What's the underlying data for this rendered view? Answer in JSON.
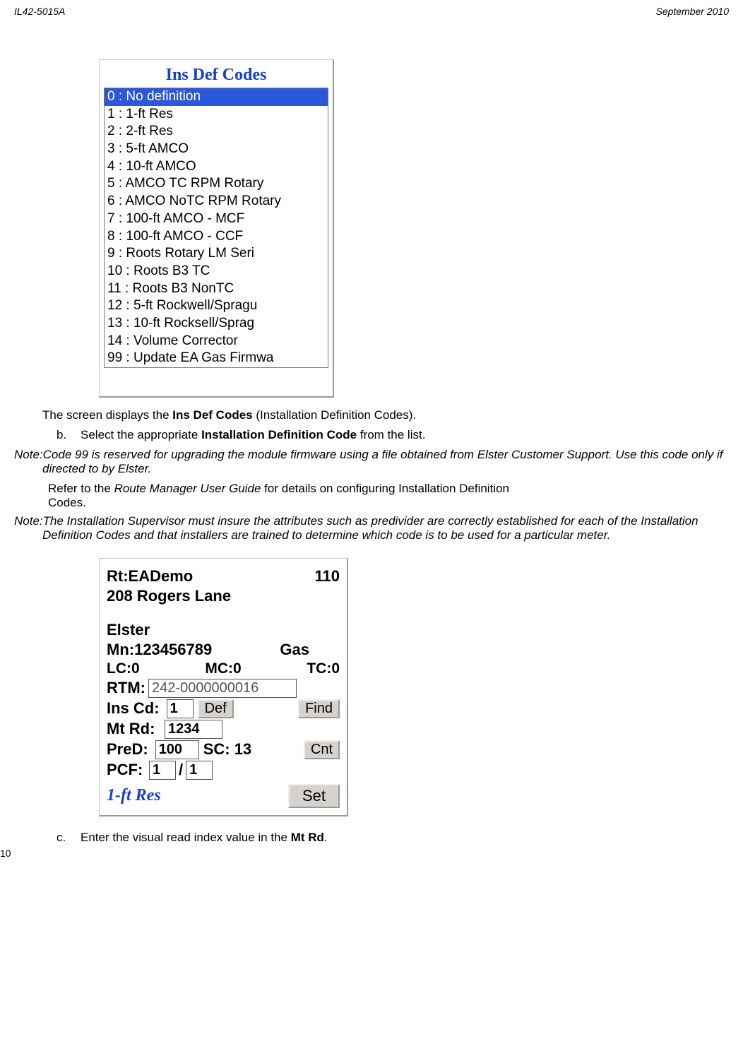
{
  "header": {
    "left": "IL42-5015A",
    "right": "September 2010",
    "page_number": "10"
  },
  "panel1": {
    "title": "Ins Def Codes",
    "items": [
      {
        "text": "0 : No definition",
        "selected": true
      },
      {
        "text": "1 : 1-ft Res"
      },
      {
        "text": "2 : 2-ft Res"
      },
      {
        "text": "3 : 5-ft AMCO"
      },
      {
        "text": "4 : 10-ft AMCO"
      },
      {
        "text": "5 : AMCO TC RPM Rotary"
      },
      {
        "text": "6 : AMCO NoTC RPM Rotary"
      },
      {
        "text": "7 : 100-ft AMCO - MCF"
      },
      {
        "text": "8 : 100-ft AMCO - CCF"
      },
      {
        "text": "9 : Roots Rotary LM Seri"
      },
      {
        "text": "10 : Roots B3 TC"
      },
      {
        "text": "11 : Roots B3 NonTC"
      },
      {
        "text": "12 : 5-ft Rockwell/Spragu"
      },
      {
        "text": "13 : 10-ft Rocksell/Sprag"
      },
      {
        "text": "14 : Volume Corrector"
      },
      {
        "text": "99 : Update EA Gas Firmwa"
      }
    ]
  },
  "text": {
    "screen_displays_pre": "The screen displays the ",
    "ins_def_codes_bold": "Ins Def Codes",
    "screen_displays_post": " (Installation Definition Codes).",
    "b_bullet": "b.",
    "b_text_pre": "Select the appropriate ",
    "b_text_bold": "Installation Definition Code",
    "b_text_post": " from the list.",
    "note1_prefix": "Note: ",
    "note1_body": "Code 99 is reserved for upgrading the module firmware using a file obtained from Elster Customer Support. Use this code only if directed to by Elster.",
    "refer_pre": "Refer to the ",
    "refer_ital": "Route Manager User Guide",
    "refer_post": " for details on configuring Installation Definition Codes.",
    "note2_prefix": "Note: ",
    "note2_body": "The Installation Supervisor must insure the attributes such as predivider are correctly established for each of the Installation Definition Codes and that installers are trained to determine which code is to be used for a particular meter.",
    "c_bullet": "c.",
    "c_text_pre": "Enter the visual read index value in the ",
    "c_text_bold": "Mt Rd",
    "c_text_post": "."
  },
  "panel2": {
    "rt_label": "Rt:EADemo",
    "rt_num": "110",
    "address": "208 Rogers Lane",
    "company": "Elster",
    "mn_label": "Mn:123456789",
    "service": "Gas",
    "lc": "LC:0",
    "mc": "MC:0",
    "tc": "TC:0",
    "rtm_label": "RTM:",
    "rtm_value": "242-0000000016",
    "inscd_label": "Ins Cd:",
    "inscd_value": "1",
    "def_btn": "Def",
    "find_btn": "Find",
    "mtrd_label": "Mt Rd:",
    "mtrd_value": "1234",
    "pred_label": "PreD:",
    "pred_value": "100",
    "sc_label": "SC: 13",
    "cnt_btn": "Cnt",
    "pcf_label": "PCF:",
    "pcf_a": "1",
    "pcf_sep": "/",
    "pcf_b": "1",
    "footer_text": "1-ft Res",
    "set_btn": "Set"
  }
}
